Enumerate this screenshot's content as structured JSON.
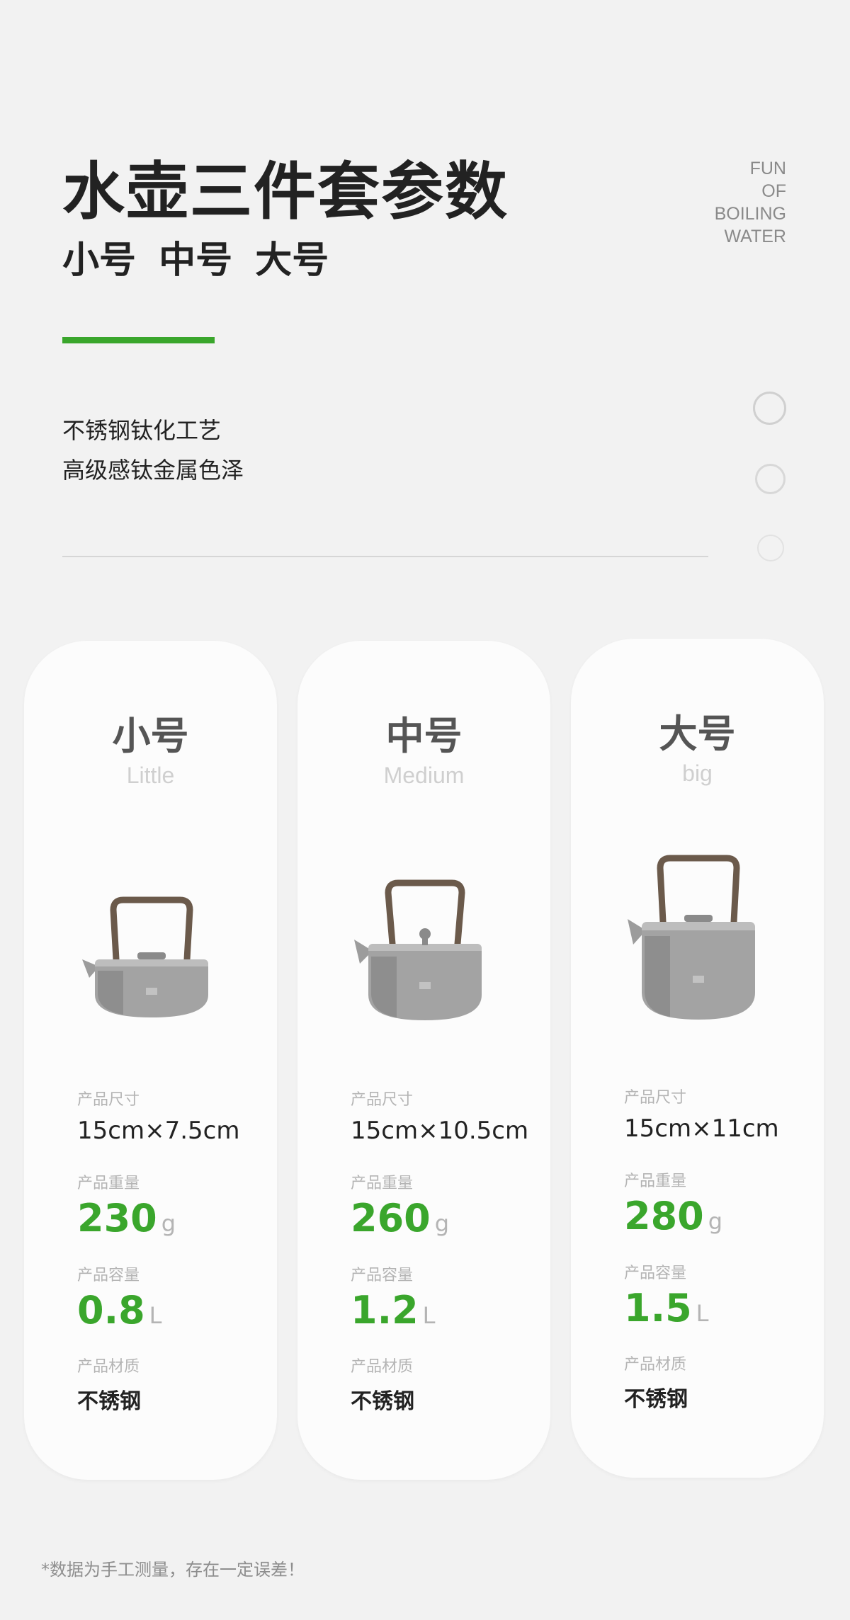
{
  "header": {
    "title": "水壶三件套参数",
    "subtitle": "小号 中号 大号",
    "tagline": [
      "FUN",
      "OF",
      "BOILING",
      "WATER"
    ],
    "description": [
      "不锈钢钛化工艺",
      "高级感钛金属色泽"
    ]
  },
  "colors": {
    "accent": "#3aa62c",
    "background": "#f2f2f2",
    "card": "#fcfcfc"
  },
  "specs_labels": {
    "size": "产品尺寸",
    "weight": "产品重量",
    "capacity": "产品容量",
    "material": "产品材质"
  },
  "products": [
    {
      "name_zh": "小号",
      "name_en": "Little",
      "size": "15cm×7.5cm",
      "weight": "230",
      "weight_unit": "g",
      "capacity": "0.8",
      "capacity_unit": "L",
      "material": "不锈钢",
      "icon": "small-kettle-image"
    },
    {
      "name_zh": "中号",
      "name_en": "Medium",
      "size": "15cm×10.5cm",
      "weight": "260",
      "weight_unit": "g",
      "capacity": "1.2",
      "capacity_unit": "L",
      "material": "不锈钢",
      "icon": "medium-kettle-image"
    },
    {
      "name_zh": "大号",
      "name_en": "big",
      "size": "15cm×11cm",
      "weight": "280",
      "weight_unit": "g",
      "capacity": "1.5",
      "capacity_unit": "L",
      "material": "不锈钢",
      "icon": "large-kettle-image"
    }
  ],
  "footnote": "*数据为手工测量，存在一定误差！"
}
